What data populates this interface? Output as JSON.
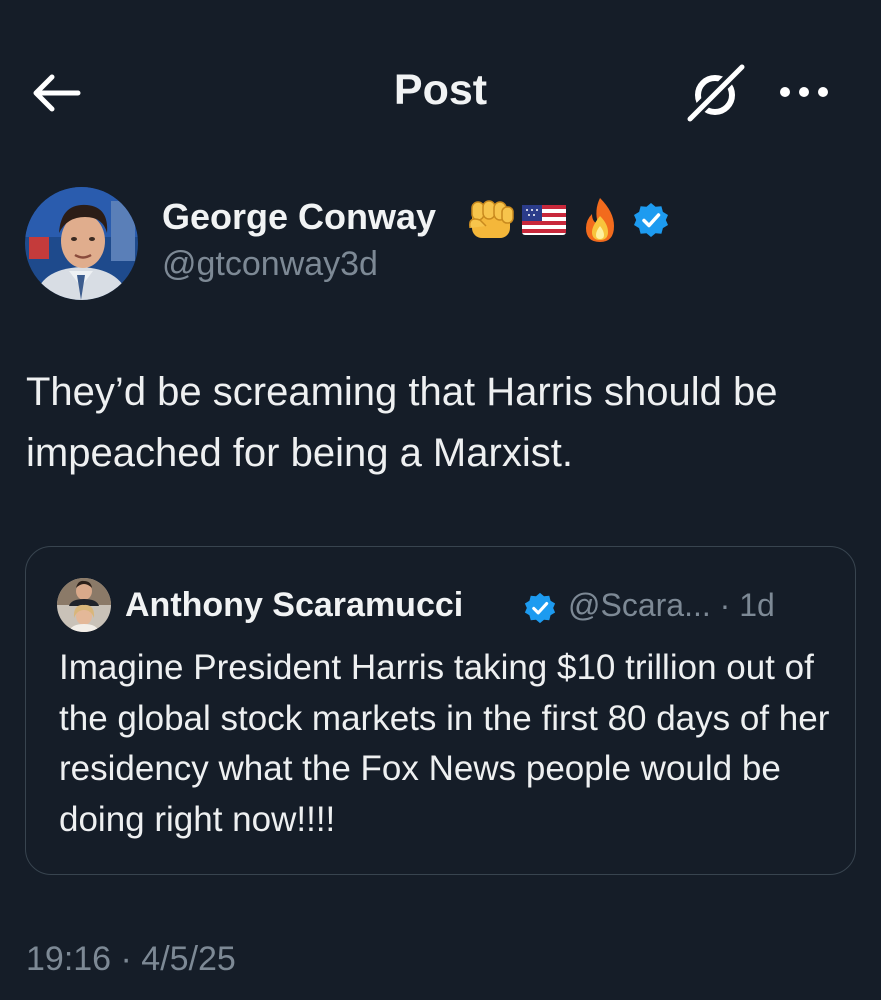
{
  "header": {
    "title": "Post",
    "back_icon": "arrow-left-icon",
    "grok_icon": "grok-icon",
    "more_icon": "more-horizontal-icon"
  },
  "author": {
    "name": "George Conway",
    "name_emojis": [
      "👊",
      "🇺🇸",
      "🔥"
    ],
    "verified_icon": "verified-badge-icon",
    "handle": "@gtconway3d"
  },
  "post": {
    "text": "They’d be screaming that Harris should be impeached for being a Marxist."
  },
  "quoted_post": {
    "author_name": "Anthony Scaramucci",
    "verified_icon": "verified-badge-icon",
    "meta": "@Scara... · 1d",
    "text": "Imagine President Harris taking $10 trillion out of the global stock markets in the first 80 days of her residency what the Fox News people would be doing right now!!!!"
  },
  "timestamp": "19:16 · 4/5/25",
  "colors": {
    "background": "#151d28",
    "text": "#e7e9ea",
    "secondary_text": "#7d8995",
    "verified_blue": "#1d9bf0",
    "border": "#38444f"
  }
}
